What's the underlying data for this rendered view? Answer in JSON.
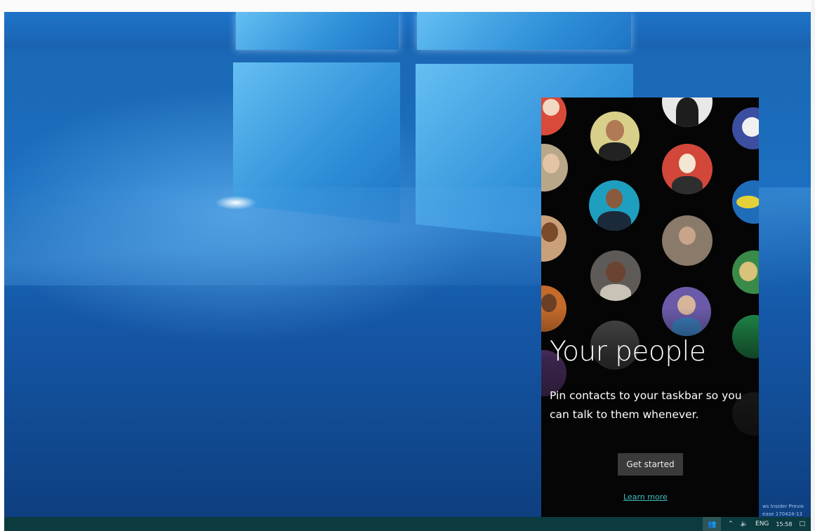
{
  "flyout": {
    "title": "Your people",
    "description": "Pin contacts to your taskbar so you can talk to them whenever.",
    "primary_button": "Get started",
    "link": "Learn more"
  },
  "taskbar": {
    "tray_language": "ENG",
    "clock_time": "15:58"
  },
  "watermark": {
    "line1": "ws Insider Previe",
    "line2": "ease 170424-13"
  },
  "colors": {
    "desktop_blue": "#1a66b2",
    "flyout_bg": "#050505",
    "button_bg": "#3a3a3a",
    "link_teal": "#3fbfbf",
    "taskbar_bg": "#0b3b3e"
  },
  "icons": [
    "people-icon",
    "chevron-up-icon",
    "volume-icon",
    "notification-icon"
  ]
}
